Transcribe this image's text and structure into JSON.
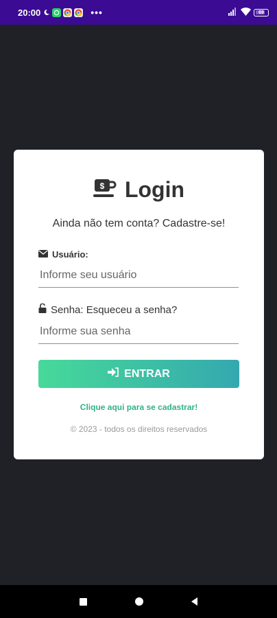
{
  "status_bar": {
    "time": "20:00",
    "dots": "•••",
    "battery": "69"
  },
  "login": {
    "title": "Login",
    "subtitle": "Ainda não tem conta? Cadastre-se!",
    "user_label": "Usuário:",
    "user_placeholder": "Informe seu usuário",
    "user_value": "",
    "password_label": "Senha: Esqueceu a senha?",
    "password_placeholder": "Informe sua senha",
    "password_value": "",
    "enter_button": "ENTRAR",
    "register_link": "Clique aqui para se cadastrar!",
    "copyright": "© 2023 - todos os direitos reservados"
  },
  "colors": {
    "status_bar": "#3b0b93",
    "background": "#1f2127",
    "accent_green": "#47d99a",
    "accent_teal": "#34a8b0",
    "link": "#2fb28a"
  }
}
